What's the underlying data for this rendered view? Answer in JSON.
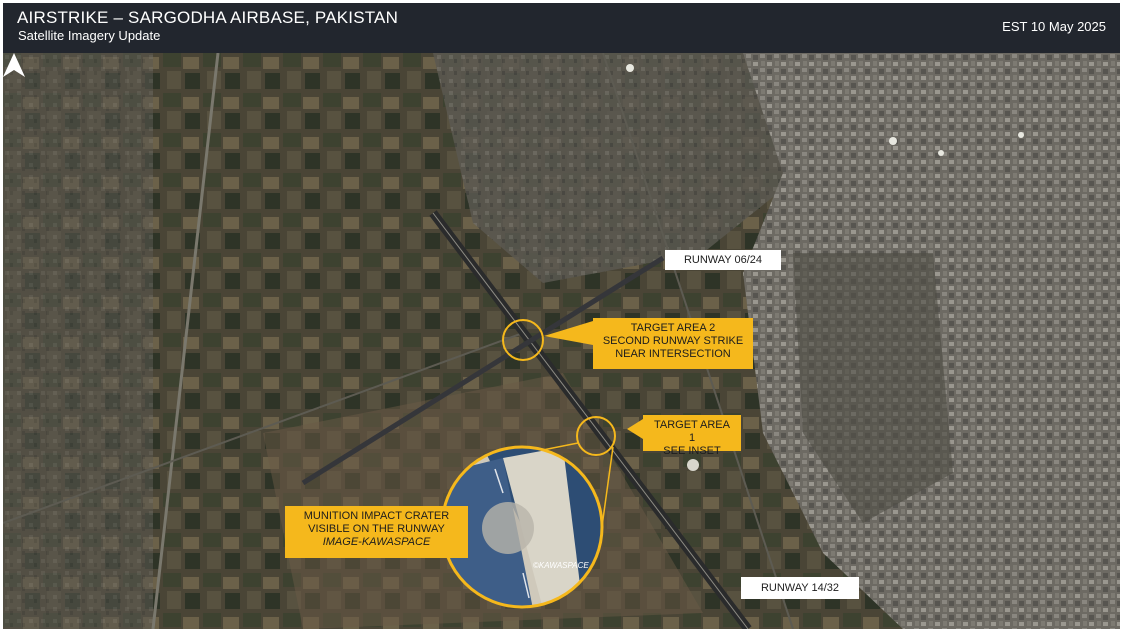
{
  "header": {
    "title": "AIRSTRIKE – SARGODHA AIRBASE, PAKISTAN",
    "subtitle": "Satellite Imagery Update",
    "date": "EST 10 May 2025"
  },
  "labels": {
    "runway_0624": "RUNWAY 06/24",
    "runway_1432": "RUNWAY 14/32"
  },
  "callouts": {
    "target2": {
      "line1": "TARGET AREA 2",
      "line2": "SECOND RUNWAY STRIKE",
      "line3": "NEAR INTERSECTION"
    },
    "target1": {
      "line1": "TARGET AREA 1",
      "line2": "SEE INSET"
    },
    "crater": {
      "line1": "MUNITION IMPACT CRATER",
      "line2": "VISIBLE ON THE RUNWAY",
      "line3": "IMAGE-KAWASPACE"
    }
  },
  "inset": {
    "watermark": "©KAWASPACE"
  },
  "icons": {
    "north": "north-arrow-icon"
  },
  "colors": {
    "callout": "#f5b81c",
    "header": "#22262e",
    "circle": "#f5b81c"
  }
}
